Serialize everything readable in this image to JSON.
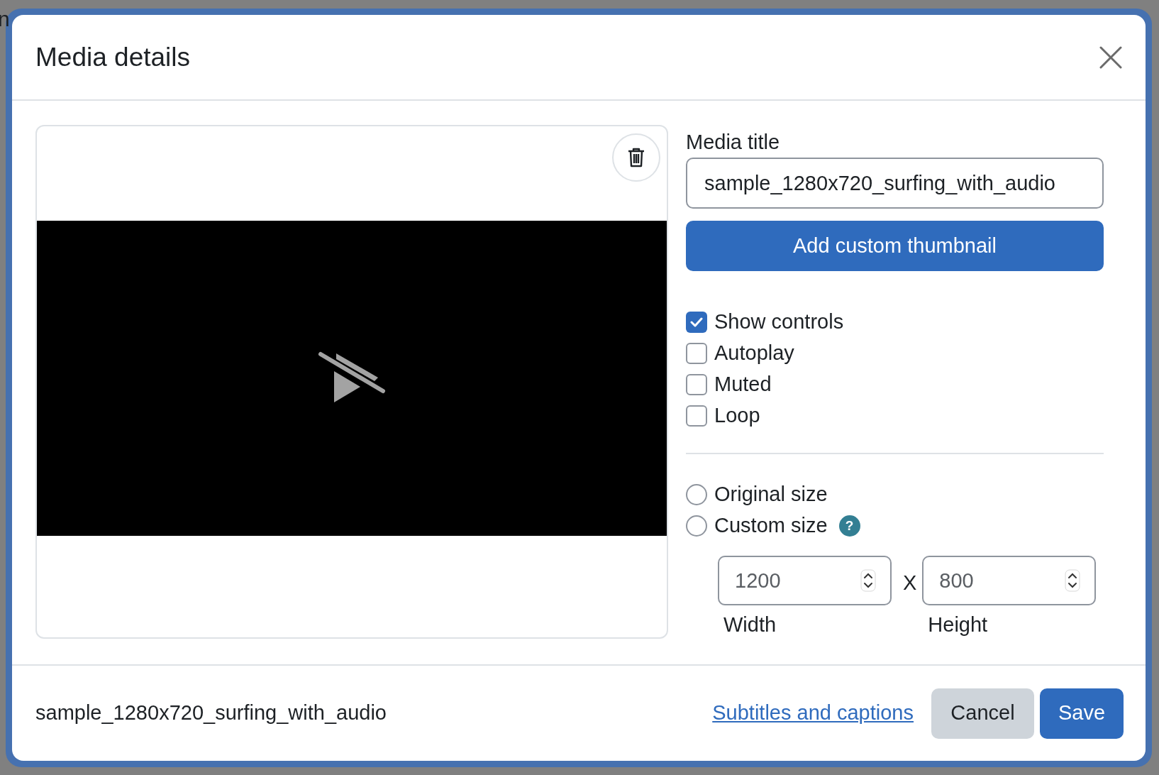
{
  "background": {
    "heading": "n"
  },
  "dialog": {
    "title": "Media details"
  },
  "media": {
    "kind": "video"
  },
  "form": {
    "title_label": "Media title",
    "title_value": "sample_1280x720_surfing_with_audio",
    "thumbnail_button": "Add custom thumbnail",
    "options": [
      {
        "label": "Show controls",
        "checked": true
      },
      {
        "label": "Autoplay",
        "checked": false
      },
      {
        "label": "Muted",
        "checked": false
      },
      {
        "label": "Loop",
        "checked": false
      }
    ],
    "sizes": [
      {
        "label": "Original size",
        "selected": false
      },
      {
        "label": "Custom size",
        "selected": false,
        "help": "?"
      }
    ],
    "width": {
      "placeholder": "1200",
      "label": "Width"
    },
    "separator": "X",
    "height": {
      "placeholder": "800",
      "label": "Height"
    }
  },
  "footer": {
    "filename": "sample_1280x720_surfing_with_audio",
    "link": "Subtitles and captions",
    "buttons": [
      {
        "label": "Cancel",
        "kind": "secondary"
      },
      {
        "label": "Save",
        "kind": "primary"
      }
    ]
  }
}
